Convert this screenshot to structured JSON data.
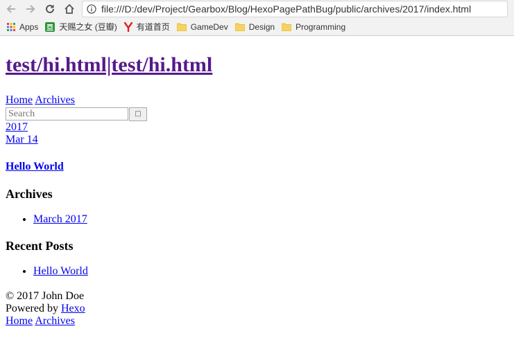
{
  "browser": {
    "url": "file:///D:/dev/Project/Gearbox/Blog/HexoPagePathBug/public/archives/2017/index.html",
    "bookmarks": [
      {
        "label": "Apps",
        "icon": "apps-grid-icon"
      },
      {
        "label": "天赐之女 (豆瓣)",
        "icon": "douban-icon"
      },
      {
        "label": "有道首页",
        "icon": "youdao-icon"
      },
      {
        "label": "GameDev",
        "icon": "folder-icon"
      },
      {
        "label": "Design",
        "icon": "folder-icon"
      },
      {
        "label": "Programming",
        "icon": "folder-icon"
      }
    ]
  },
  "site": {
    "title": "test/hi.html|test/hi.html",
    "nav": {
      "home": "Home",
      "archives": "Archives"
    },
    "search": {
      "placeholder": "Search",
      "button": ""
    }
  },
  "archive": {
    "year": "2017",
    "date": "Mar 14",
    "post_title": "Hello World"
  },
  "widgets": {
    "archives": {
      "title": "Archives",
      "items": [
        "March 2017"
      ]
    },
    "recent_posts": {
      "title": "Recent Posts",
      "items": [
        "Hello World"
      ]
    }
  },
  "footer": {
    "copyright": "© 2017 John Doe",
    "powered_prefix": "Powered by ",
    "powered_link": "Hexo",
    "nav": {
      "home": "Home",
      "archives": "Archives"
    }
  }
}
